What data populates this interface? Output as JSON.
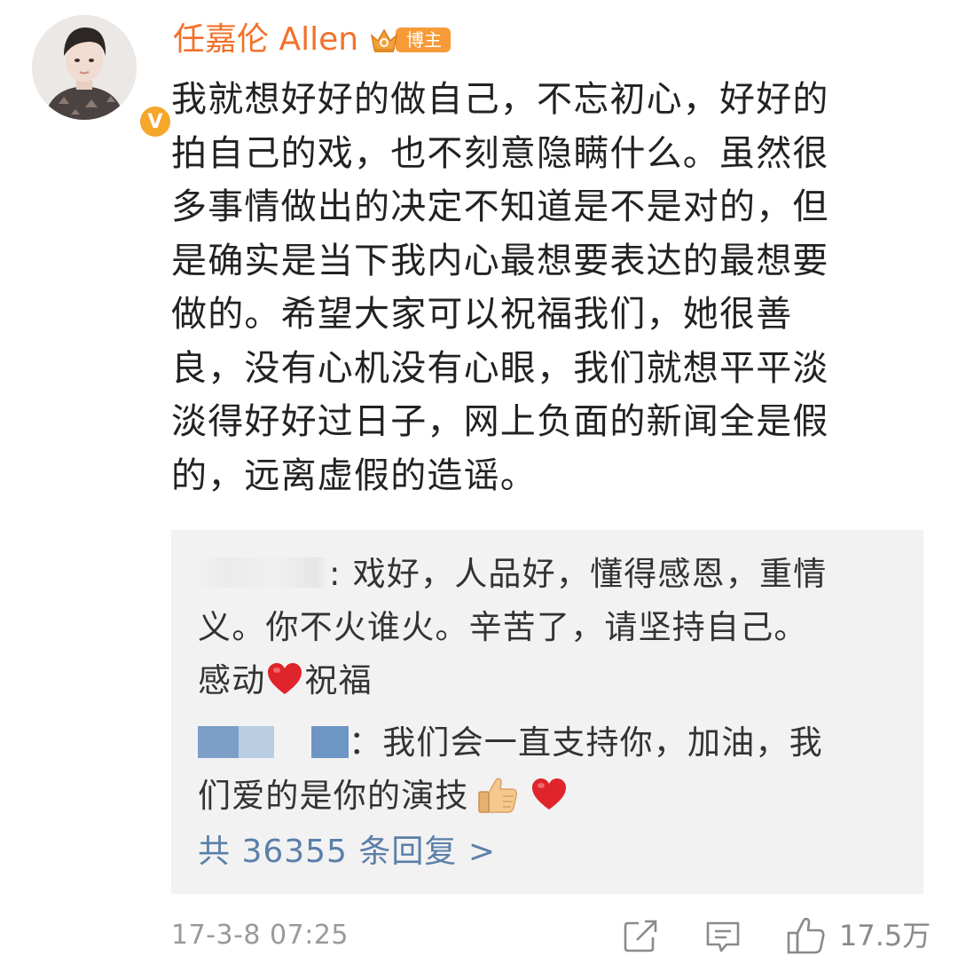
{
  "post": {
    "username": "任嘉伦 Allen",
    "badge_label": "博主",
    "verified_mark": "V",
    "text_lines": [
      "我就想好好的做自己，不忘初心，好好的",
      "拍自己的戏，也不刻意隐瞒什么。虽然很",
      "多事情做出的决定不知道是不是对的，但",
      "是确实是当下我内心最想要表达的最想要",
      "做的。希望大家可以祝福我们，她很善",
      "良，没有心机没有心眼，我们就想平平淡",
      "淡得好好过日子，网上负面的新闻全是假",
      "的，远离虚假的造谣。"
    ],
    "timestamp": "17-3-8 07:25",
    "like_count": "17.5万"
  },
  "replies": {
    "reply1": {
      "line1_text": ": 戏好，人品好，懂得感恩，重情",
      "line2": "义。你不火谁火。辛苦了，请坚持自己。",
      "line3_before": "感动",
      "line3_after": "祝福"
    },
    "reply2": {
      "line1_text": "：我们会一直支持你，加油，我",
      "line2_text": "们爱的是你的演技"
    },
    "more_label": "共 36355 条回复 >"
  },
  "colors": {
    "username": "#f2712b",
    "badge": "#f79a37",
    "verified": "#f4a72b",
    "link": "#5b7fa9",
    "reply_bg": "#f2f2f2",
    "meta": "#9a9a9a",
    "heart": "#e0242b"
  },
  "icons": [
    "crown-icon",
    "verified-icon",
    "heart-emoji-icon",
    "thumbs-up-emoji-icon",
    "share-icon",
    "comment-icon",
    "like-icon"
  ]
}
